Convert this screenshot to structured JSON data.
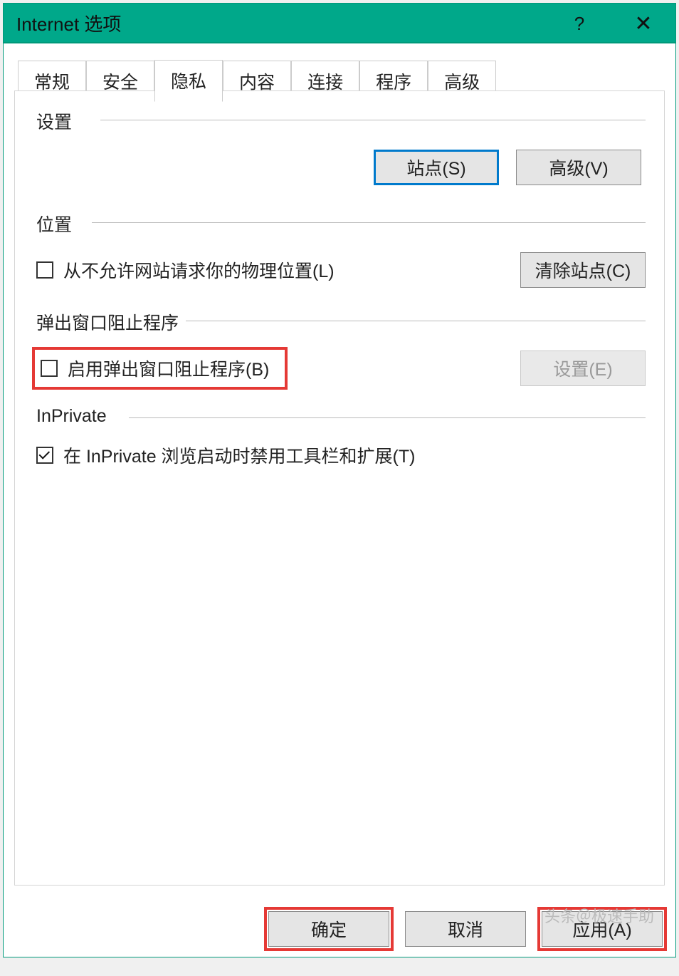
{
  "window": {
    "title": "Internet 选项",
    "help": "?",
    "close": "✕"
  },
  "tabs": {
    "general": "常规",
    "security": "安全",
    "privacy": "隐私",
    "content": "内容",
    "connections": "连接",
    "programs": "程序",
    "advanced": "高级"
  },
  "sections": {
    "settings_label": "设置",
    "sites_button": "站点(S)",
    "advanced_button": "高级(V)",
    "location_label": "位置",
    "location_checkbox": "从不允许网站请求你的物理位置(L)",
    "clear_sites_button": "清除站点(C)",
    "popup_label": "弹出窗口阻止程序",
    "popup_checkbox": "启用弹出窗口阻止程序(B)",
    "popup_settings_button": "设置(E)",
    "inprivate_label": "InPrivate",
    "inprivate_checkbox": "在 InPrivate 浏览启动时禁用工具栏和扩展(T)"
  },
  "buttons": {
    "ok": "确定",
    "cancel": "取消",
    "apply": "应用(A)"
  },
  "watermark": "头条＠极速手助"
}
